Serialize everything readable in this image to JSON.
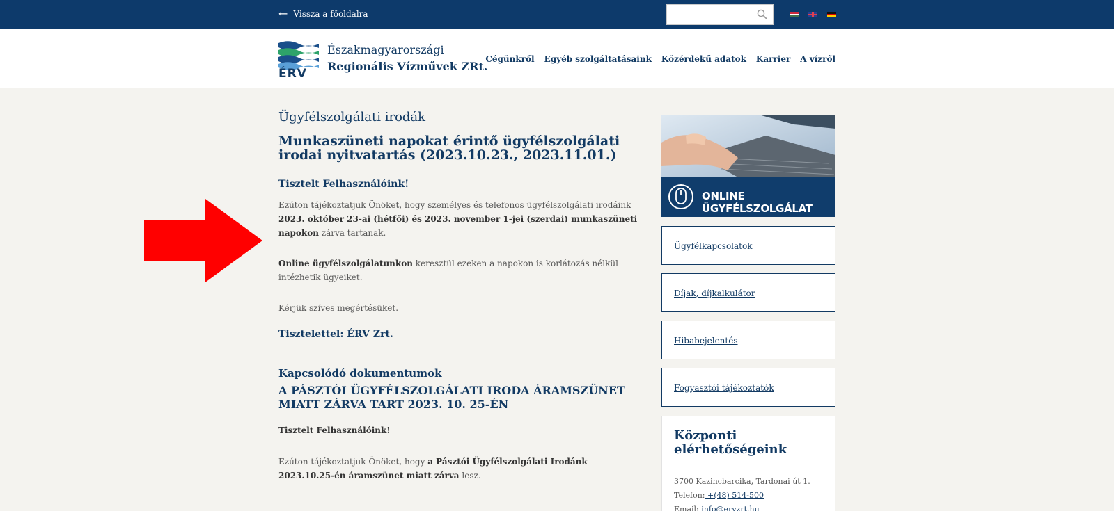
{
  "topbar": {
    "back_label": "Vissza a főoldalra",
    "search_placeholder": "",
    "flags": [
      "hu-flag",
      "uk-flag",
      "de-flag"
    ]
  },
  "header": {
    "logo_text": "ÉRV",
    "company_line1": "Északmagyarországi",
    "company_line2": "Regionális Vízművek ZRt.",
    "nav": [
      "Cégünkről",
      "Egyéb szolgáltatásaink",
      "Közérdekű adatok",
      "Karrier",
      "A vízről"
    ]
  },
  "main": {
    "page_title": "Ügyfélszolgálati irodák",
    "article_title": "Munkaszüneti napokat érintő ügyfélszolgálati irodai nyitvatartás (2023.10.23., 2023.11.01.)",
    "greeting": "Tisztelt Felhasználóink!",
    "p1_a": "Ezúton tájékoztatjuk Önöket, hogy személyes és telefonos ügyfélszolgálati irodáink ",
    "p1_b": "2023. október 23-ai (hétfői) és 2023. november 1-jei (szerdai) munkaszüneti napokon",
    "p1_c": " zárva tartanak.",
    "p2_a": "Online ügyfélszolgálatunkon",
    "p2_b": " keresztül ezeken a napokon is korlátozás nélkül intézhetik ügyeiket.",
    "p3": "Kérjük szíves megértésüket.",
    "signoff": "Tisztelettel: ÉRV Zrt.",
    "related_heading": "Kapcsolódó dokumentumok",
    "related_title": "A PÁSZTÓI ÜGYFÉLSZOLGÁLATI IRODA ÁRAMSZÜNET MIATT ZÁRVA TART 2023. 10. 25-ÉN",
    "related_greeting": "Tisztelt Felhasználóink!",
    "related_p_a": "Ezúton tájékoztatjuk Önöket, hogy ",
    "related_p_b": "a Pásztói Ügyfélszolgálati Irodánk 2023.10.25-én áramszünet miatt zárva",
    "related_p_c": " lesz."
  },
  "sidebar": {
    "banner_text": "ONLINE ÜGYFÉLSZOLGÁLAT",
    "links": [
      "Ügyfélkapcsolatok",
      "Díjak, díjkalkulátor",
      "Hibabejelentés",
      "Fogyasztói tájékoztatók"
    ],
    "contact_title": "Központi elérhetőségeink",
    "address": "3700 Kazincbarcika, Tardonai út 1.",
    "phone_label": "Telefon:",
    "phone": " +(48) 514-500",
    "email_label": "Email: ",
    "email": "info@ervzrt.hu"
  },
  "colors": {
    "navy": "#0d3a6b",
    "text_blue": "#123a63",
    "annotation_red": "#ff0000",
    "page_bg": "#f4f3ef"
  }
}
